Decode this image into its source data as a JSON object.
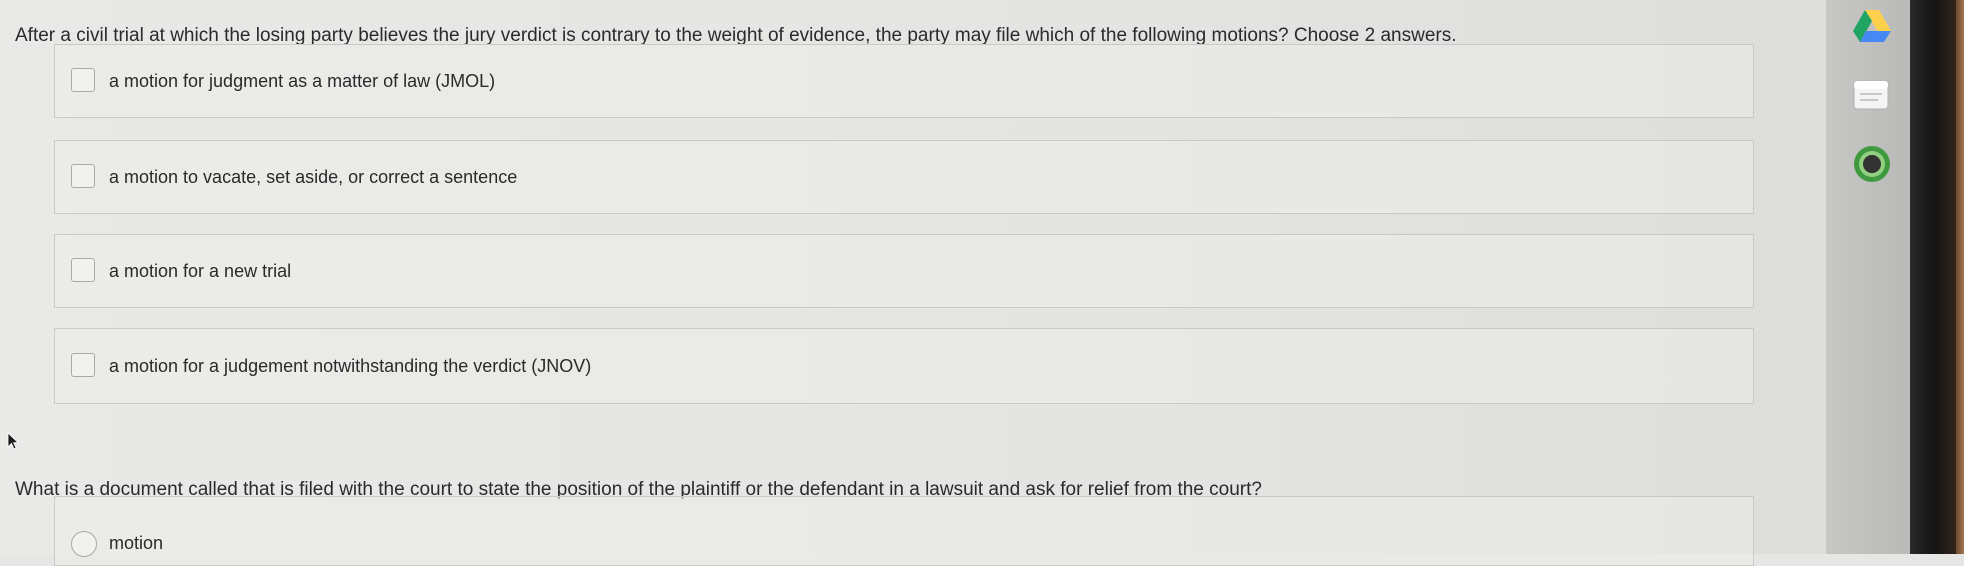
{
  "question1": {
    "prompt": "After a civil trial at which the losing party believes the jury verdict is contrary to the weight of evidence, the party may file which of the following motions? Choose 2 answers.",
    "options": [
      {
        "label": "a motion for judgment as a matter of law (JMOL)",
        "checked": false
      },
      {
        "label": "a motion to vacate, set aside, or correct a sentence",
        "checked": false
      },
      {
        "label": "a motion for a new trial",
        "checked": false
      },
      {
        "label": "a motion for a judgement notwithstanding the verdict (JNOV)",
        "checked": false
      }
    ]
  },
  "question2": {
    "prompt": "What is a document called that is filed with the court to state the position of the plaintiff or the defendant in a lawsuit and ask for relief from the court?",
    "options": [
      {
        "label": "motion",
        "selected": false
      }
    ]
  },
  "sidebar": {
    "icons": [
      "google-drive-icon",
      "google-docs-icon",
      "app-circle-icon"
    ]
  },
  "colors": {
    "drive_green": "#1fa463",
    "drive_yellow": "#ffd04b",
    "drive_blue": "#4688f4",
    "circle_green": "#3f9a3f"
  }
}
